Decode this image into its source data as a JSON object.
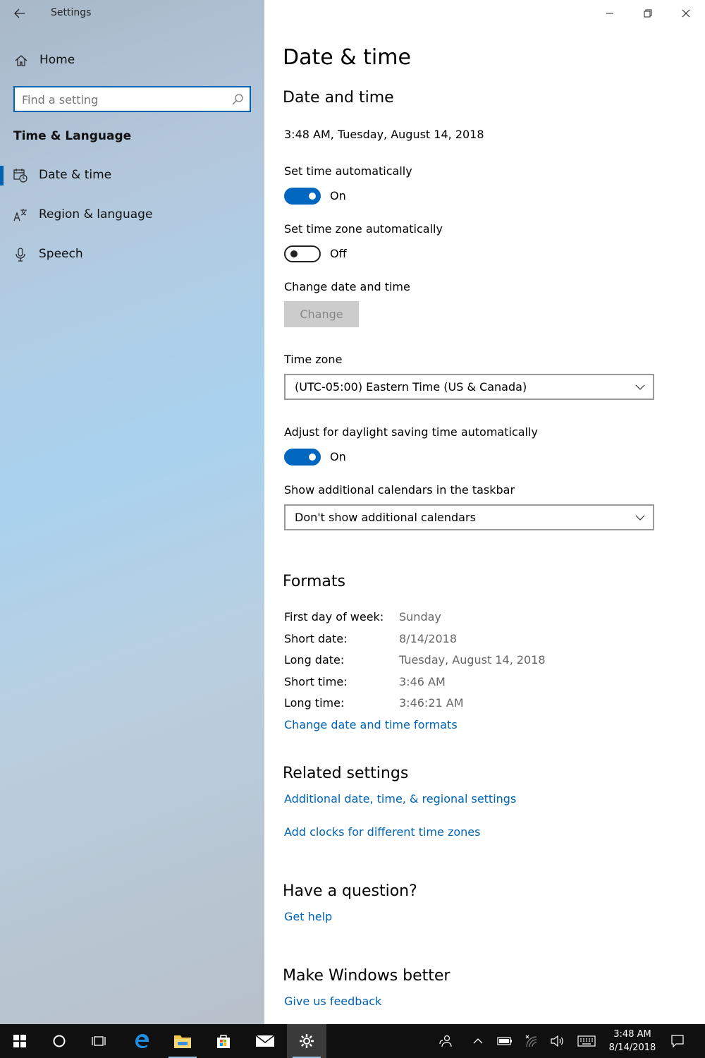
{
  "window": {
    "title": "Settings"
  },
  "sidebar": {
    "home_label": "Home",
    "search_placeholder": "Find a setting",
    "section_title": "Time & Language",
    "items": [
      {
        "label": "Date & time",
        "icon": "calendar-clock-icon",
        "active": true
      },
      {
        "label": "Region & language",
        "icon": "language-icon",
        "active": false
      },
      {
        "label": "Speech",
        "icon": "microphone-icon",
        "active": false
      }
    ]
  },
  "main": {
    "page_title": "Date & time",
    "date_and_time": {
      "heading": "Date and time",
      "current": "3:48 AM, Tuesday, August 14, 2018",
      "set_time_auto_label": "Set time automatically",
      "set_time_auto_state": "On",
      "set_tz_auto_label": "Set time zone automatically",
      "set_tz_auto_state": "Off",
      "change_label": "Change date and time",
      "change_button": "Change",
      "timezone_label": "Time zone",
      "timezone_value": "(UTC-05:00) Eastern Time (US & Canada)",
      "dst_label": "Adjust for daylight saving time automatically",
      "dst_state": "On",
      "calendars_label": "Show additional calendars in the taskbar",
      "calendars_value": "Don't show additional calendars"
    },
    "formats": {
      "heading": "Formats",
      "rows": [
        {
          "label": "First day of week:",
          "value": "Sunday"
        },
        {
          "label": "Short date:",
          "value": "8/14/2018"
        },
        {
          "label": "Long date:",
          "value": "Tuesday, August 14, 2018"
        },
        {
          "label": "Short time:",
          "value": "3:46 AM"
        },
        {
          "label": "Long time:",
          "value": "3:46:21 AM"
        }
      ],
      "change_link": "Change date and time formats"
    },
    "related": {
      "heading": "Related settings",
      "link1": "Additional date, time, & regional settings",
      "link2": "Add clocks for different time zones"
    },
    "question": {
      "heading": "Have a question?",
      "link": "Get help"
    },
    "feedback": {
      "heading": "Make Windows better",
      "link": "Give us feedback"
    }
  },
  "taskbar": {
    "time": "3:48 AM",
    "date": "8/14/2018",
    "apps": [
      "windows-start-icon",
      "cortana-icon",
      "task-view-icon",
      "edge-icon",
      "file-explorer-icon",
      "store-icon",
      "mail-icon",
      "settings-gear-icon"
    ]
  },
  "colors": {
    "accent": "#0063b1",
    "toggle_on": "#0067c0",
    "taskbar": "#101010"
  }
}
